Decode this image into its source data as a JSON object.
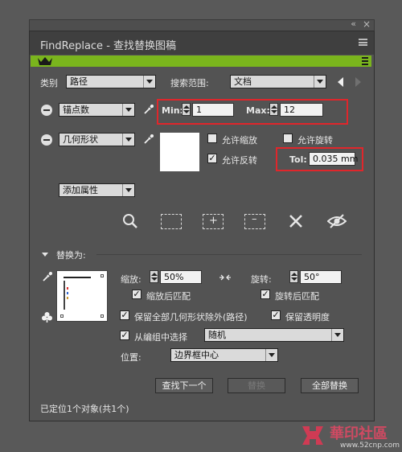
{
  "window": {
    "title": "FindReplace - 查找替换图稿"
  },
  "find": {
    "category_label": "类别",
    "category_value": "路径",
    "scope_label": "搜索范围:",
    "scope_value": "文档",
    "attr1": {
      "value": "锚点数",
      "min_label": "Min:",
      "min_value": "1",
      "max_label": "Max:",
      "max_value": "12"
    },
    "attr2": {
      "value": "几何形状",
      "allow_scale": "允许缩放",
      "allow_rotate": "允许旋转",
      "allow_reflect": "允许反转",
      "allow_reflect_checked": true,
      "tol_label": "Tol:",
      "tol_value": "0.035 mm"
    },
    "add_attribute": "添加属性"
  },
  "replace": {
    "header": "替换为:",
    "scale_label": "缩放:",
    "scale_value": "50%",
    "rotate_label": "旋转:",
    "rotate_value": "50°",
    "match_scale": "缩放后匹配",
    "match_rotate": "旋转后匹配",
    "keep_geometry": "保留全部几何形状除外(路径)",
    "keep_transparency": "保留透明度",
    "select_from_group": "从编组中选择",
    "select_from_group_value": "随机",
    "position_label": "位置:",
    "position_value": "边界框中心"
  },
  "buttons": {
    "find_next": "查找下一个",
    "replace": "替换",
    "replace_all": "全部替换"
  },
  "status": "已定位1个对象(共1个)",
  "watermark": {
    "brand": "華印社區",
    "url": "www.52cnp.com"
  },
  "colors": {
    "accent_green": "#7ab51d",
    "highlight_red": "#e0262b"
  }
}
